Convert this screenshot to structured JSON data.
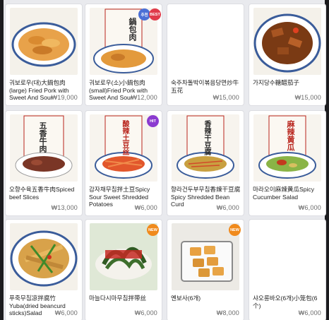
{
  "menu": {
    "items": [
      {
        "name": "궈보로우(대)大鍋包肉(large) Fried Pork with Sweet And Sour",
        "price": "₩19,000",
        "badges": []
      },
      {
        "name": "궈보로우(소)小鍋包肉(small)Fried Pork with Sweet And Sour",
        "price": "₩12,000",
        "badges": [
          "추천",
          "BEST"
        ],
        "poster_text": "鍋包肉"
      },
      {
        "name": "숙주차돌박이볶음당면炒牛五花",
        "price": "₩15,000",
        "badges": []
      },
      {
        "name": "가지당수糖醋茄子",
        "price": "₩15,000",
        "badges": []
      },
      {
        "name": "오향수육五香牛肉Spiced beef Slices",
        "price": "₩13,000",
        "badges": [],
        "poster_text": "五香牛肉"
      },
      {
        "name": "감자채무침拌土豆Spicy Sour Sweet Shredded Potatoes",
        "price": "₩6,000",
        "badges": [
          "HIT"
        ],
        "poster_text": "酸辣土豆丝"
      },
      {
        "name": "향라건두부무침香辣干豆腐Spicy Shredded Bean Curd",
        "price": "₩6,000",
        "badges": [],
        "poster_text": "香辣干豆腐"
      },
      {
        "name": "마라오이麻辣黄瓜Spicy Cucumber Salad",
        "price": "₩6,000",
        "badges": [],
        "poster_text": "麻辣黄瓜"
      },
      {
        "name": "푸죽무침凉拌腐竹Yuba(dried beancurd sticks)Salad",
        "price": "₩6,000",
        "badges": []
      },
      {
        "name": "마늘다시마무침拌带丝",
        "price": "₩6,000",
        "badges": [
          "NEW"
        ]
      },
      {
        "name": "옌보사(6개)",
        "price": "₩8,000",
        "badges": [
          "NEW"
        ]
      },
      {
        "name": "샤오롱바오(6개)小笼包(6个)",
        "price": "₩6,000",
        "badges": []
      }
    ]
  }
}
